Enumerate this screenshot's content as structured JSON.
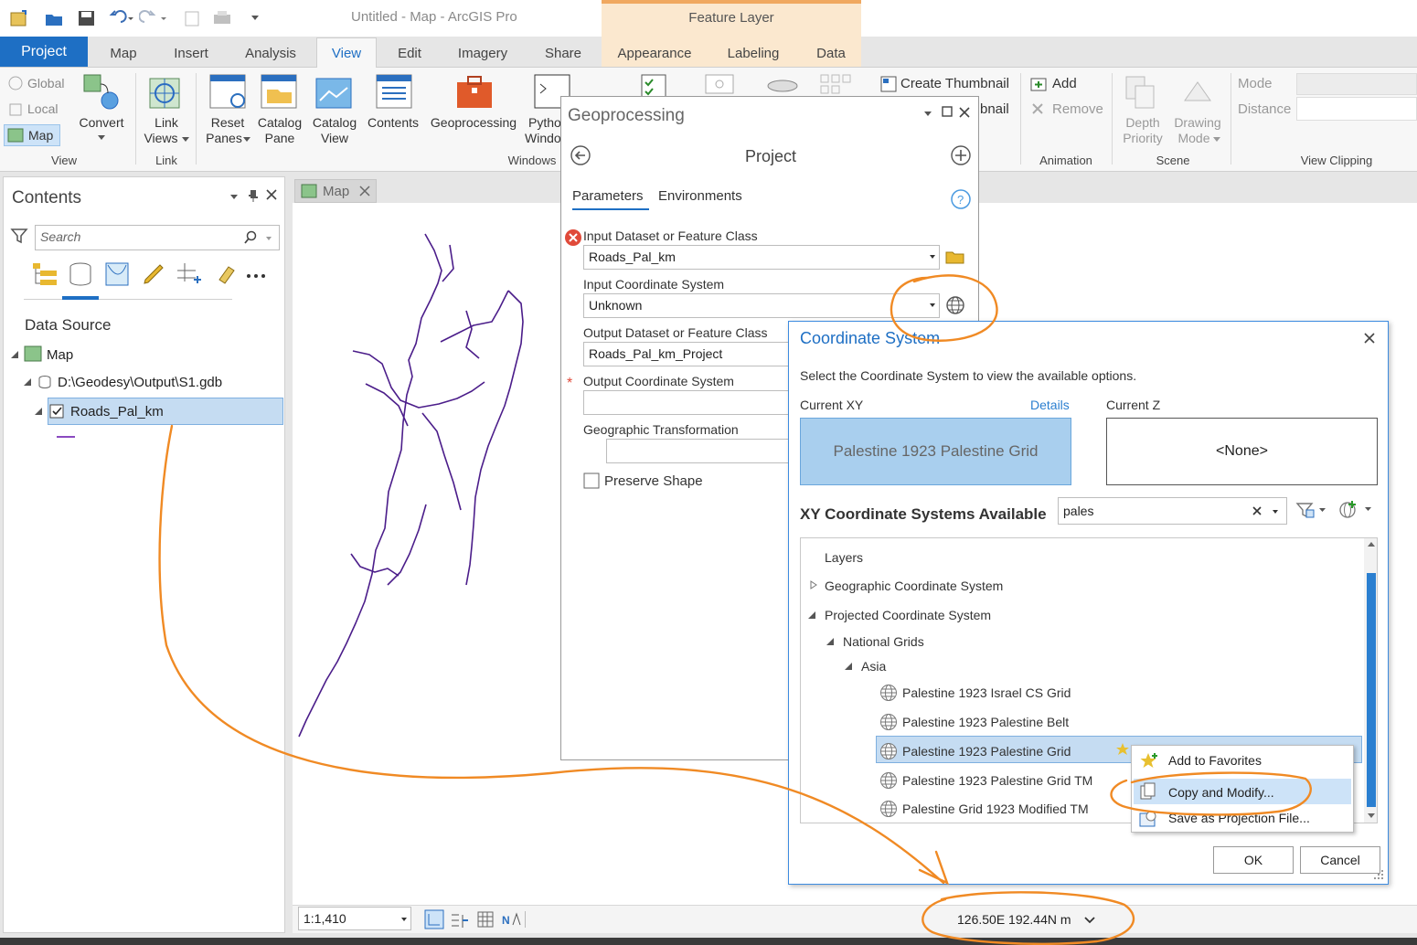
{
  "title_bar": {
    "app_title": "Untitled - Map - ArcGIS Pro",
    "context_tab": "Feature Layer"
  },
  "tabs": [
    "Project",
    "Map",
    "Insert",
    "Analysis",
    "View",
    "Edit",
    "Imagery",
    "Share",
    "Appearance",
    "Labeling",
    "Data"
  ],
  "ribbon": {
    "view_group": {
      "global": "Global",
      "local": "Local",
      "map": "Map",
      "convert": "Convert",
      "label": "View"
    },
    "link_group": {
      "link_views": "Link",
      "link_views2": "Views",
      "label": "Link"
    },
    "windows_group": {
      "reset_panes": "Reset",
      "reset_panes2": "Panes",
      "catalog_pane": "Catalog",
      "catalog_pane2": "Pane",
      "catalog_view": "Catalog",
      "catalog_view2": "View",
      "contents": "Contents",
      "geoprocessing": "Geoprocessing",
      "python": "Pytho",
      "python2": "Windo",
      "label": "Windows"
    },
    "thumbnail": {
      "create": "Create Thumbnail",
      "create2": "bnail"
    },
    "animation_group": {
      "add": "Add",
      "remove": "Remove",
      "label": "Animation"
    },
    "scene_group": {
      "depth": "Depth",
      "depth2": "Priority",
      "drawing": "Drawing",
      "drawing2": "Mode",
      "label": "Scene"
    },
    "clipping_group": {
      "mode": "Mode",
      "distance": "Distance",
      "label": "View Clipping"
    }
  },
  "contents": {
    "title": "Contents",
    "search_placeholder": "Search",
    "section": "Data Source",
    "items": [
      "Map",
      "D:\\Geodesy\\Output\\S1.gdb",
      "Roads_Pal_km"
    ]
  },
  "map_tab": "Map",
  "status": {
    "scale": "1:1,410",
    "coords": "126.50E 192.44N m"
  },
  "geoprocessing": {
    "title": "Geoprocessing",
    "tool": "Project",
    "tab_params": "Parameters",
    "tab_env": "Environments",
    "input_dataset_label": "Input Dataset or Feature Class",
    "input_dataset_value": "Roads_Pal_km",
    "input_cs_label": "Input Coordinate System",
    "input_cs_value": "Unknown",
    "output_dataset_label": "Output Dataset or Feature Class",
    "output_dataset_value": "Roads_Pal_km_Project",
    "output_cs_label": "Output Coordinate System",
    "geo_transform_label": "Geographic Transformation",
    "preserve_shape_label": "Preserve Shape"
  },
  "coord_dialog": {
    "title": "Coordinate System",
    "instruction": "Select the Coordinate System to view the available options.",
    "current_xy_label": "Current XY",
    "details_link": "Details",
    "current_xy_value": "Palestine 1923 Palestine Grid",
    "current_z_label": "Current Z",
    "current_z_value": "<None>",
    "available_label": "XY Coordinate Systems Available",
    "search_value": "pales",
    "tree": {
      "layers": "Layers",
      "geographic": "Geographic Coordinate System",
      "projected": "Projected Coordinate System",
      "national": "National Grids",
      "asia": "Asia",
      "items": [
        "Palestine 1923 Israel CS Grid",
        "Palestine 1923 Palestine Belt",
        "Palestine 1923 Palestine Grid",
        "Palestine 1923 Palestine Grid TM",
        "Palestine Grid 1923 Modified TM"
      ]
    },
    "ok": "OK",
    "cancel": "Cancel"
  },
  "context_menu": [
    "Add to Favorites",
    "Copy and Modify...",
    "Save as Projection File..."
  ],
  "colors": {
    "accent": "#1e6fc4",
    "annotation": "#f08a24",
    "road_line": "#4b1d8a",
    "selection": "#c5dcf2"
  }
}
